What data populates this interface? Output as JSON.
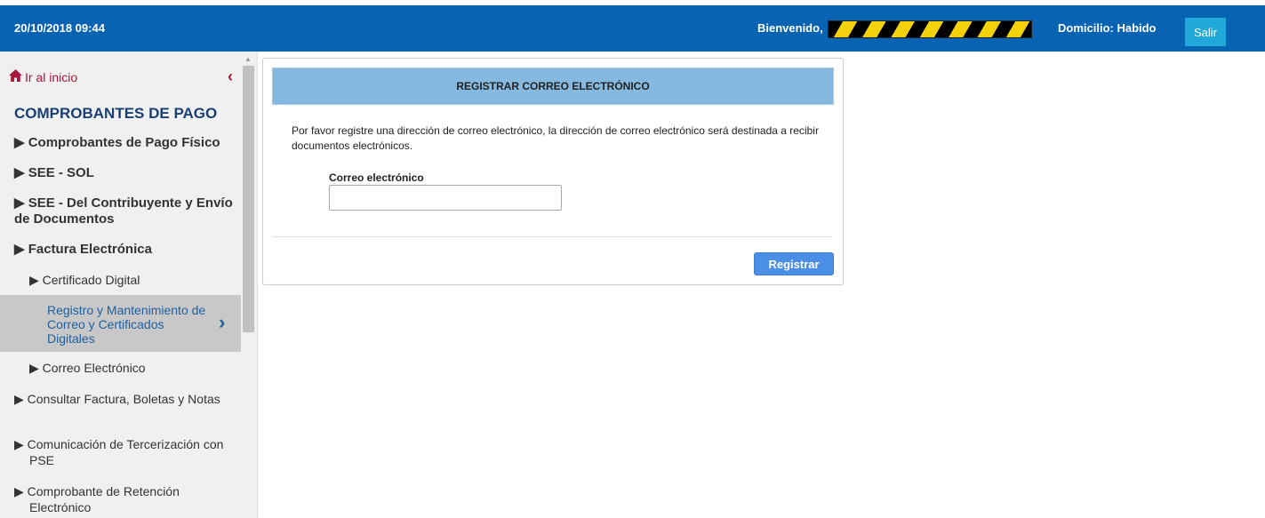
{
  "header": {
    "datetime": "20/10/2018 09:44",
    "welcome_label": "Bienvenido,",
    "domicilio": "Domicilio: Habido",
    "logout_label": "Salir"
  },
  "sidebar": {
    "home_icon": "home-icon",
    "home_label": "Ir al inicio",
    "collapse_glyph": "‹",
    "section_title": "COMPROBANTES DE PAGO",
    "items": [
      {
        "label": "Comprobantes de Pago Físico"
      },
      {
        "label": "SEE - SOL"
      },
      {
        "label": "SEE - Del Contribuyente y Envío de Documentos"
      },
      {
        "label": "Factura Electrónica"
      },
      {
        "label": "Certificado Digital"
      },
      {
        "label": "Registro y Mantenimiento de Correo y Certificados Digitales"
      },
      {
        "label": "Correo Electrónico"
      },
      {
        "label": "Consultar Factura, Boletas y Notas"
      },
      {
        "label": "Comunicación de Tercerización con PSE"
      },
      {
        "label": "Comprobante de Retención Electrónico"
      }
    ]
  },
  "form": {
    "title": "REGISTRAR CORREO ELECTRÓNICO",
    "description": "Por favor registre una dirección de correo electrónico, la dirección de correo electrónico será destinada a recibir documentos electrónicos.",
    "email_label": "Correo electrónico",
    "email_value": "",
    "submit_label": "Registrar"
  },
  "colors": {
    "header_bg": "#0863b2",
    "logout_bg": "#1fa8d8",
    "section_title": "#1a3f73",
    "home_link": "#a8183a",
    "active_item_text": "#1e5fa0",
    "panel_header_bg": "#85b9e0",
    "submit_bg": "#4a8ee5"
  }
}
